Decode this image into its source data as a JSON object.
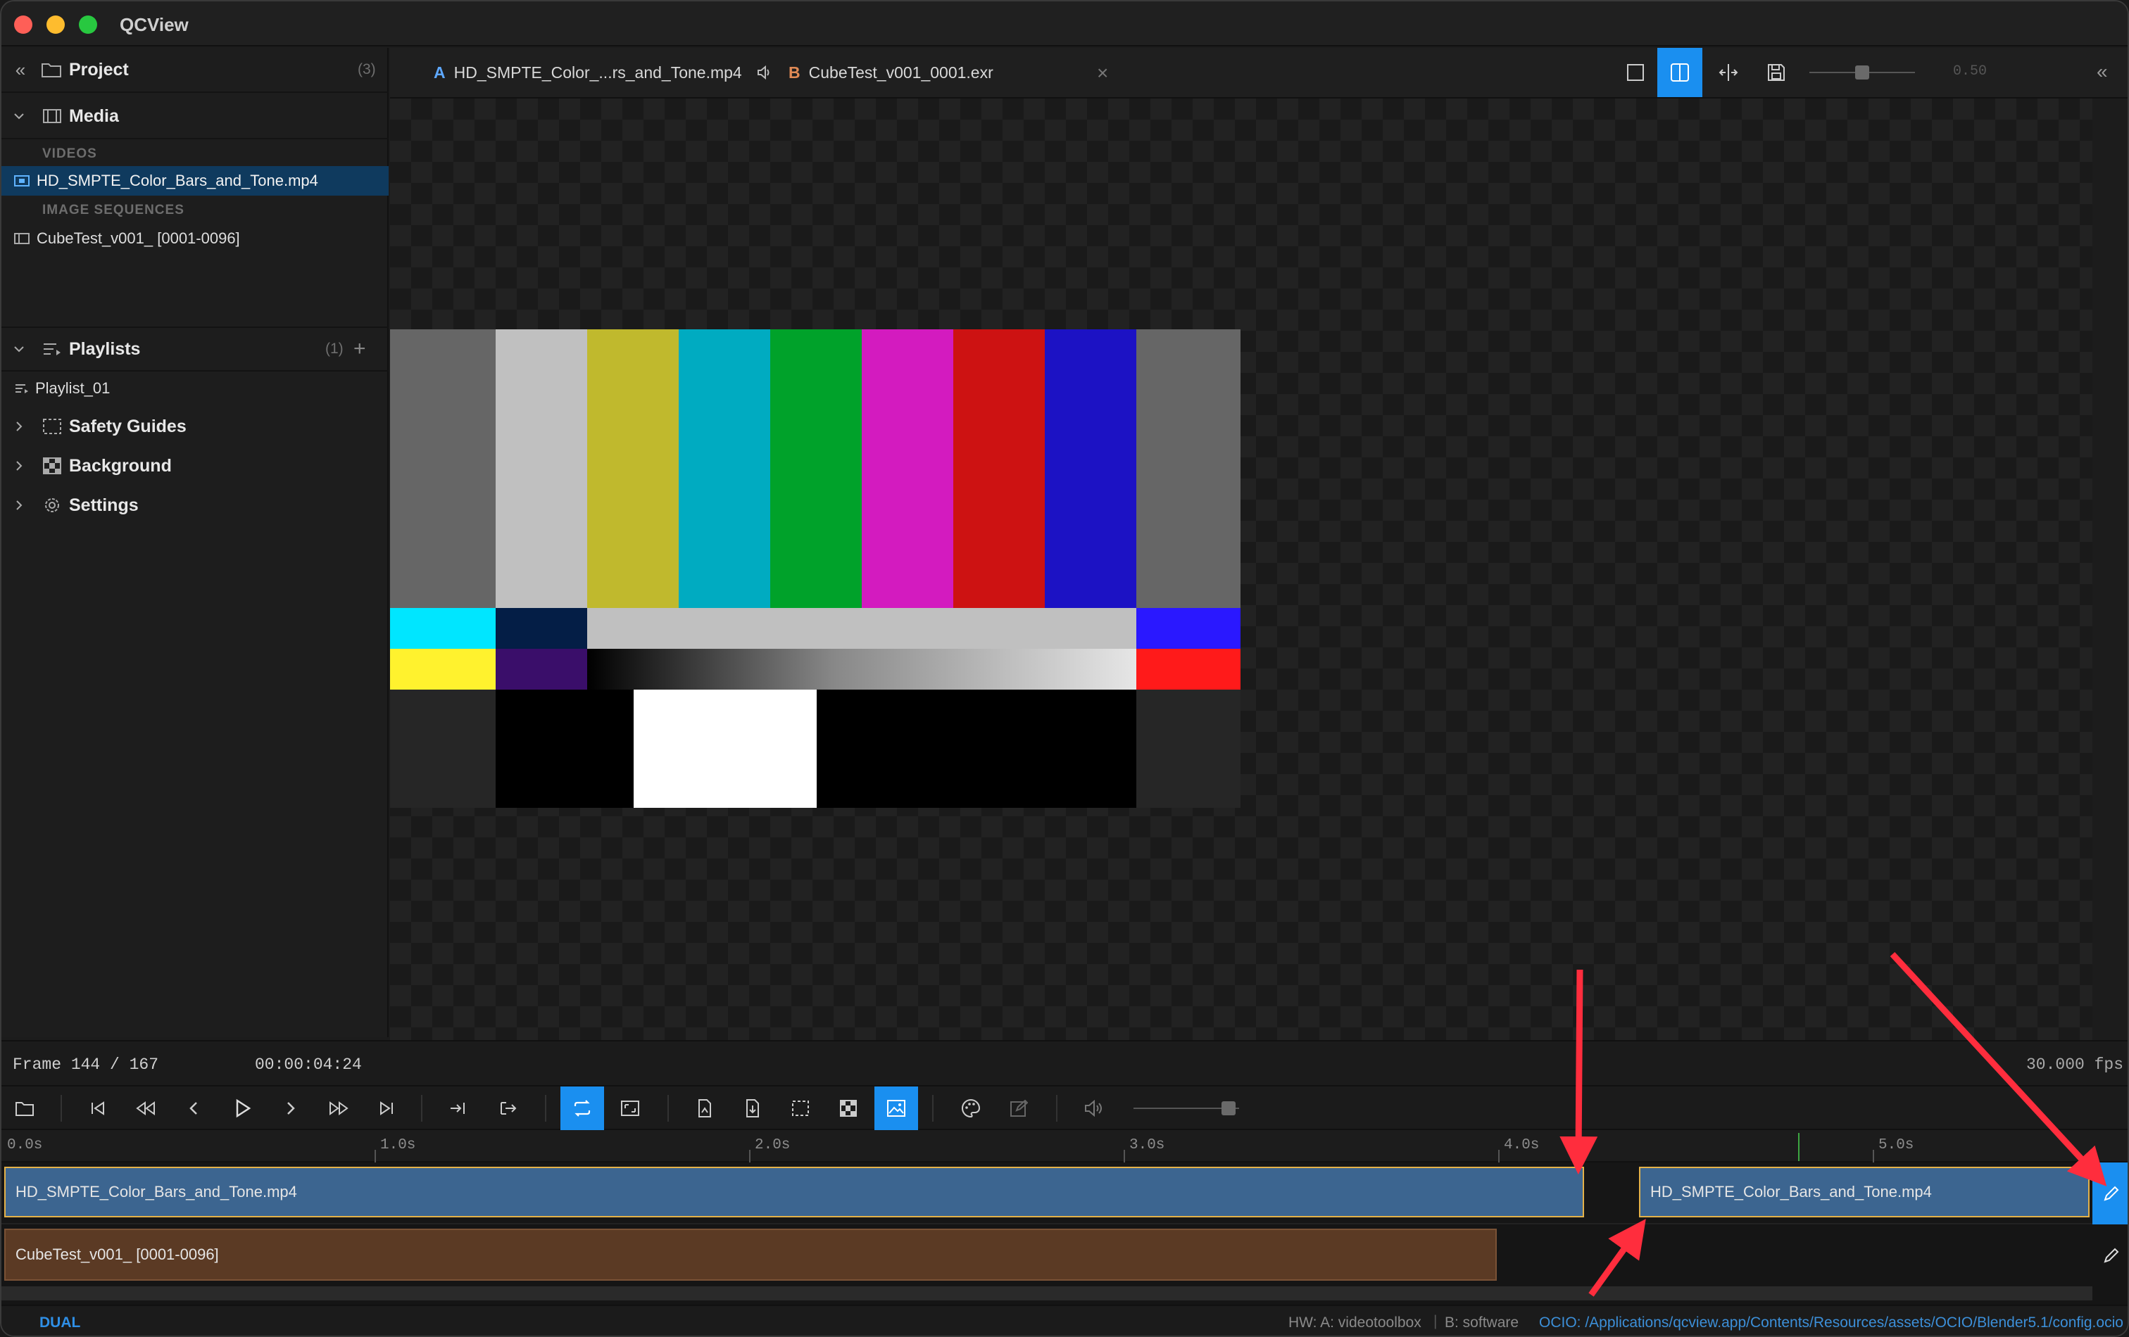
{
  "app": {
    "title": "QCView"
  },
  "colors": {
    "accent": "#1a8ff0",
    "clip_a": "#3c6590",
    "clip_a_border": "#e4b24a",
    "clip_b": "#5b3a24",
    "annotation": "#ff2d3d"
  },
  "sidebar": {
    "project": {
      "label": "Project",
      "count": "(3)"
    },
    "media": {
      "label": "Media",
      "videos_header": "VIDEOS",
      "video_item": "HD_SMPTE_Color_Bars_and_Tone.mp4",
      "sequences_header": "IMAGE SEQUENCES",
      "sequence_item": "CubeTest_v001_ [0001-0096]"
    },
    "playlists": {
      "label": "Playlists",
      "count": "(1)",
      "item": "Playlist_01"
    },
    "safety_guides": "Safety Guides",
    "background": "Background",
    "settings": "Settings"
  },
  "tabs": {
    "a": {
      "letter": "A",
      "label": "HD_SMPTE_Color_...rs_and_Tone.mp4"
    },
    "b": {
      "letter": "B",
      "label": "CubeTest_v001_0001.exr"
    }
  },
  "viewer_toolbar": {
    "opacity_value": "0.50",
    "opacity_level": 0.5
  },
  "frame": {
    "label": "Frame 144 / 167",
    "timecode": "00:00:04:24",
    "fps": "30.000 fps"
  },
  "volume_level": 0.9,
  "ruler": {
    "labels": [
      "0.0s",
      "1.0s",
      "2.0s",
      "3.0s",
      "4.0s",
      "5.0s"
    ]
  },
  "tracks": {
    "a_clip_1": "HD_SMPTE_Color_Bars_and_Tone.mp4",
    "a_clip_2": "HD_SMPTE_Color_Bars_and_Tone.mp4",
    "b_clip": "CubeTest_v001_ [0001-0096]"
  },
  "status": {
    "mode": "DUAL",
    "hw": "HW: A: videotoolbox",
    "hw_b": "B: software",
    "ocio": "OCIO: /Applications/qcview.app/Contents/Resources/assets/OCIO/Blender5.1/config.ocio"
  }
}
